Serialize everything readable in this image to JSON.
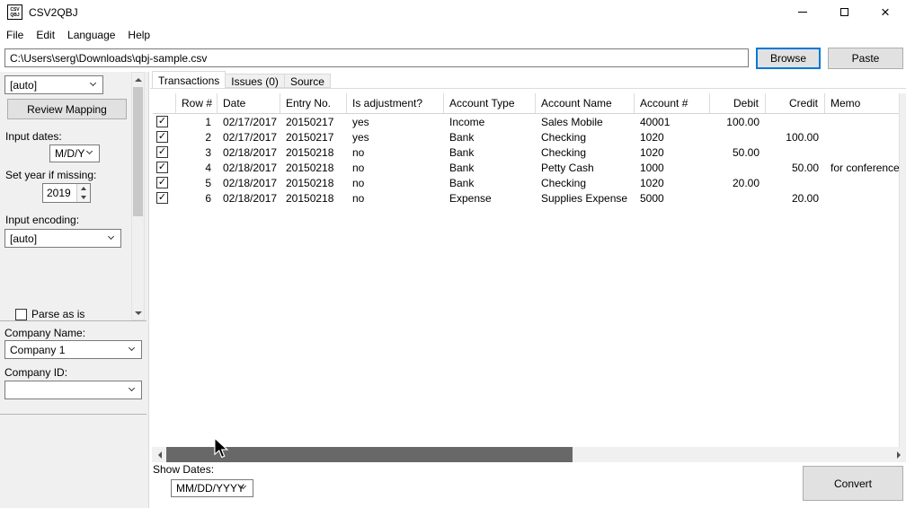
{
  "window": {
    "title": "CSV2QBJ",
    "icon_top": "CSV",
    "icon_bottom": "QBJ"
  },
  "menu": {
    "items": [
      "File",
      "Edit",
      "Language",
      "Help"
    ]
  },
  "toolbar": {
    "path_value": "C:\\Users\\serg\\Downloads\\qbj-sample.csv",
    "browse_label": "Browse",
    "paste_label": "Paste"
  },
  "sidebar": {
    "mapping_value": "[auto]",
    "review_mapping_label": "Review Mapping",
    "input_dates_label": "Input dates:",
    "input_dates_value": "M/D/Y",
    "set_year_label": "Set year if missing:",
    "set_year_value": "2019",
    "input_encoding_label": "Input encoding:",
    "input_encoding_value": "[auto]",
    "parse_as_is_label": "Parse as is",
    "company_name_label": "Company Name:",
    "company_name_value": "Company 1",
    "company_id_label": "Company ID:",
    "company_id_value": ""
  },
  "tabs": {
    "transactions": "Transactions",
    "issues": "Issues (0)",
    "source": "Source"
  },
  "table": {
    "columns": {
      "row": "Row #",
      "date": "Date",
      "entry": "Entry No.",
      "adj": "Is adjustment?",
      "atype": "Account Type",
      "aname": "Account Name",
      "anum": "Account #",
      "debit": "Debit",
      "credit": "Credit",
      "memo": "Memo"
    },
    "rows": [
      {
        "checked": true,
        "row": "1",
        "date": "02/17/2017",
        "entry": "20150217",
        "adj": "yes",
        "atype": "Income",
        "aname": "Sales Mobile",
        "anum": "40001",
        "debit": "100.00",
        "credit": "",
        "memo": ""
      },
      {
        "checked": true,
        "row": "2",
        "date": "02/17/2017",
        "entry": "20150217",
        "adj": "yes",
        "atype": "Bank",
        "aname": "Checking",
        "anum": "1020",
        "debit": "",
        "credit": "100.00",
        "memo": ""
      },
      {
        "checked": true,
        "row": "3",
        "date": "02/18/2017",
        "entry": "20150218",
        "adj": "no",
        "atype": "Bank",
        "aname": "Checking",
        "anum": "1020",
        "debit": "50.00",
        "credit": "",
        "memo": ""
      },
      {
        "checked": true,
        "row": "4",
        "date": "02/18/2017",
        "entry": "20150218",
        "adj": "no",
        "atype": "Bank",
        "aname": "Petty Cash",
        "anum": "1000",
        "debit": "",
        "credit": "50.00",
        "memo": "for conference"
      },
      {
        "checked": true,
        "row": "5",
        "date": "02/18/2017",
        "entry": "20150218",
        "adj": "no",
        "atype": "Bank",
        "aname": "Checking",
        "anum": "1020",
        "debit": "20.00",
        "credit": "",
        "memo": ""
      },
      {
        "checked": true,
        "row": "6",
        "date": "02/18/2017",
        "entry": "20150218",
        "adj": "no",
        "atype": "Expense",
        "aname": "Supplies Expense",
        "anum": "5000",
        "debit": "",
        "credit": "20.00",
        "memo": ""
      }
    ]
  },
  "footer": {
    "show_dates_label": "Show Dates:",
    "show_dates_value": "MM/DD/YYYY",
    "convert_label": "Convert"
  },
  "colors": {
    "accent": "#0078d7"
  }
}
